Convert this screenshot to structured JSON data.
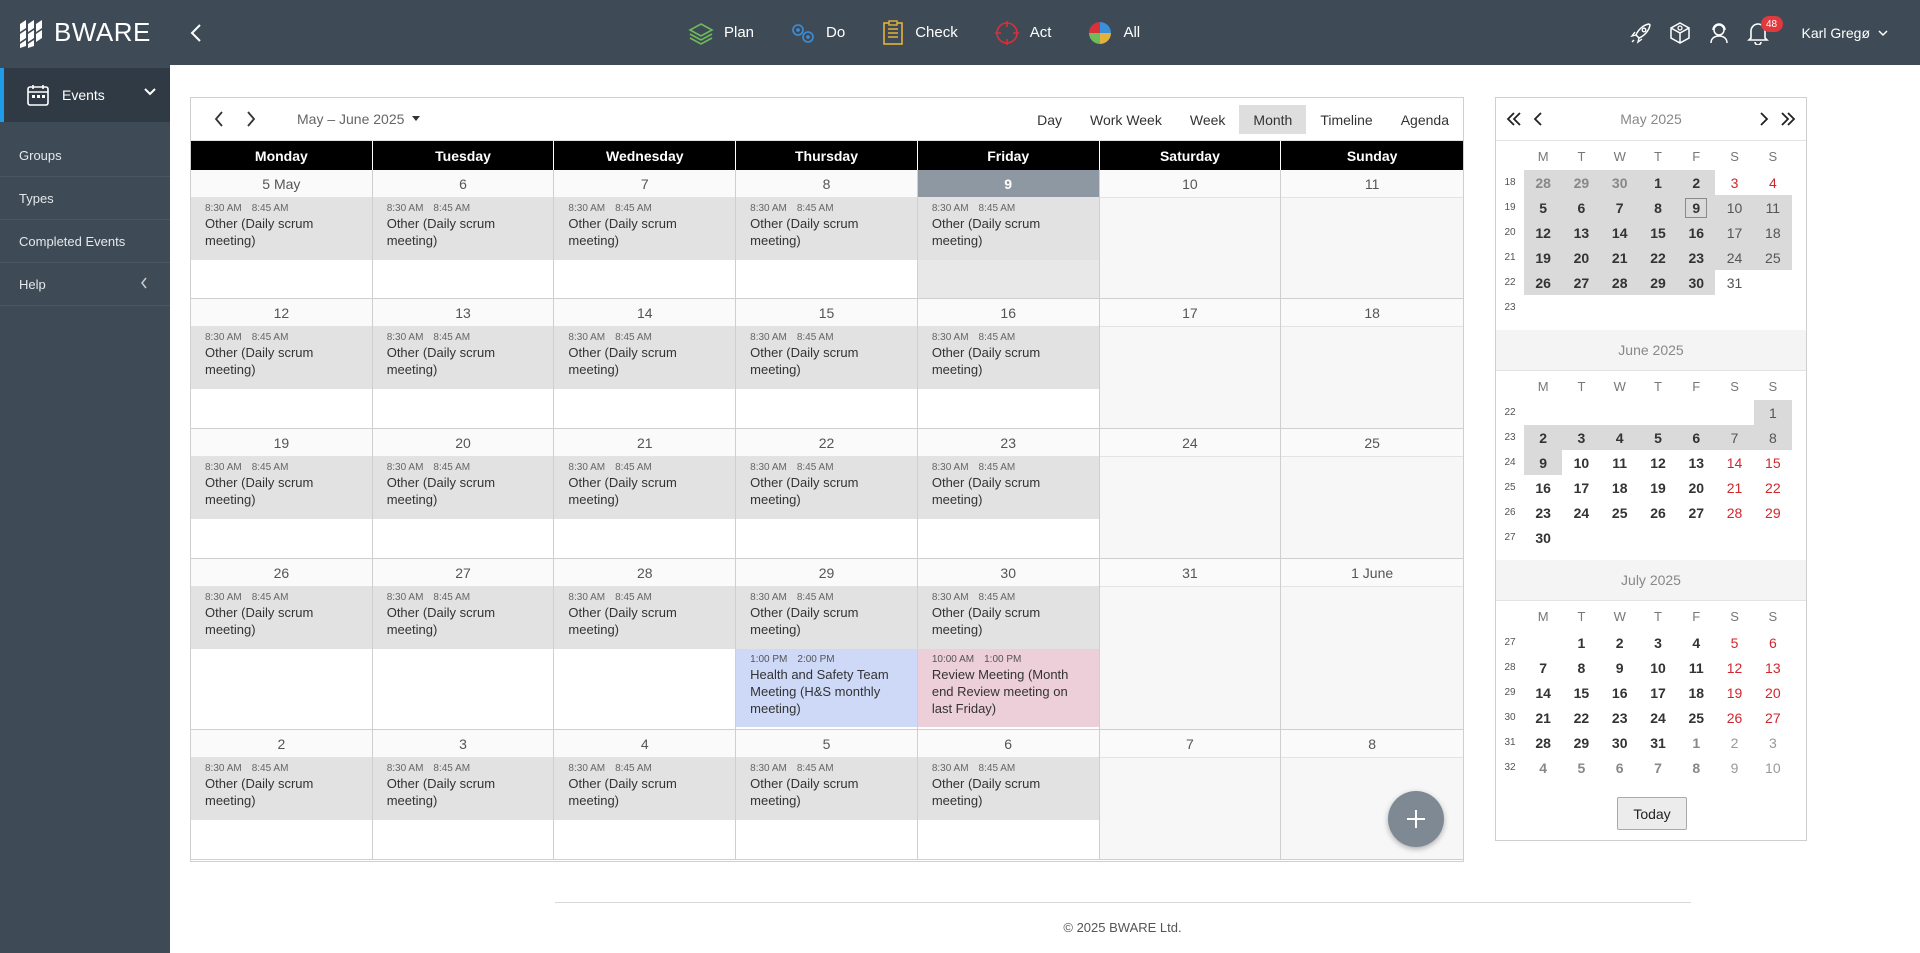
{
  "app": {
    "name": "BWARE"
  },
  "topnav": [
    {
      "label": "Plan",
      "icon": "layers-icon"
    },
    {
      "label": "Do",
      "icon": "gears-icon"
    },
    {
      "label": "Check",
      "icon": "checklist-icon"
    },
    {
      "label": "Act",
      "icon": "target-icon"
    },
    {
      "label": "All",
      "icon": "pie-chart-icon"
    }
  ],
  "user": {
    "name": "Karl Gregø",
    "notifications": "48"
  },
  "sidebar": {
    "active": "Events",
    "items": [
      "Groups",
      "Types",
      "Completed Events",
      "Help"
    ]
  },
  "calendar": {
    "range": "May – June 2025",
    "views": [
      "Day",
      "Work Week",
      "Week",
      "Month",
      "Timeline",
      "Agenda"
    ],
    "active_view": "Month",
    "day_names": [
      "Monday",
      "Tuesday",
      "Wednesday",
      "Thursday",
      "Friday",
      "Saturday",
      "Sunday"
    ],
    "weeks": [
      [
        "5 May",
        "6",
        "7",
        "8",
        "9",
        "10",
        "11"
      ],
      [
        "12",
        "13",
        "14",
        "15",
        "16",
        "17",
        "18"
      ],
      [
        "19",
        "20",
        "21",
        "22",
        "23",
        "24",
        "25"
      ],
      [
        "26",
        "27",
        "28",
        "29",
        "30",
        "31",
        "1 June"
      ],
      [
        "2",
        "3",
        "4",
        "5",
        "6",
        "7",
        "8"
      ]
    ],
    "scrum": {
      "start": "8:30 AM",
      "end": "8:45 AM",
      "title": "Other (Daily scrum meeting)"
    },
    "special_events": [
      {
        "start": "1:00 PM",
        "end": "2:00 PM",
        "title": "Health and Safety Team Meeting (H&S monthly meeting)"
      },
      {
        "start": "10:00 AM",
        "end": "1:00 PM",
        "title": "Review Meeting (Month end Review meeting on last Friday)"
      }
    ]
  },
  "mini": {
    "header": "May 2025",
    "weekday_heads": [
      "M",
      "T",
      "W",
      "T",
      "F",
      "S",
      "S"
    ],
    "months": [
      {
        "title": "May 2025",
        "weeks": [
          [
            "18",
            "28",
            "29",
            "30",
            "1",
            "2",
            "3",
            "4"
          ],
          [
            "19",
            "5",
            "6",
            "7",
            "8",
            "9",
            "10",
            "11"
          ],
          [
            "20",
            "12",
            "13",
            "14",
            "15",
            "16",
            "17",
            "18"
          ],
          [
            "21",
            "19",
            "20",
            "21",
            "22",
            "23",
            "24",
            "25"
          ],
          [
            "22",
            "26",
            "27",
            "28",
            "29",
            "30",
            "31",
            ""
          ],
          [
            "23",
            "",
            "",
            "",
            "",
            "",
            "",
            ""
          ]
        ]
      },
      {
        "title": "June 2025",
        "weeks": [
          [
            "22",
            "",
            "",
            "",
            "",
            "",
            "",
            "1"
          ],
          [
            "23",
            "2",
            "3",
            "4",
            "5",
            "6",
            "7",
            "8"
          ],
          [
            "24",
            "9",
            "10",
            "11",
            "12",
            "13",
            "14",
            "15"
          ],
          [
            "25",
            "16",
            "17",
            "18",
            "19",
            "20",
            "21",
            "22"
          ],
          [
            "26",
            "23",
            "24",
            "25",
            "26",
            "27",
            "28",
            "29"
          ],
          [
            "27",
            "30",
            "",
            "",
            "",
            "",
            "",
            ""
          ]
        ]
      },
      {
        "title": "July 2025",
        "weeks": [
          [
            "27",
            "",
            "1",
            "2",
            "3",
            "4",
            "5",
            "6"
          ],
          [
            "28",
            "7",
            "8",
            "9",
            "10",
            "11",
            "12",
            "13"
          ],
          [
            "29",
            "14",
            "15",
            "16",
            "17",
            "18",
            "19",
            "20"
          ],
          [
            "30",
            "21",
            "22",
            "23",
            "24",
            "25",
            "26",
            "27"
          ],
          [
            "31",
            "28",
            "29",
            "30",
            "31",
            "1",
            "2",
            "3"
          ],
          [
            "32",
            "4",
            "5",
            "6",
            "7",
            "8",
            "9",
            "10"
          ]
        ]
      }
    ],
    "today_label": "Today"
  },
  "footer": "© 2025 BWARE Ltd."
}
